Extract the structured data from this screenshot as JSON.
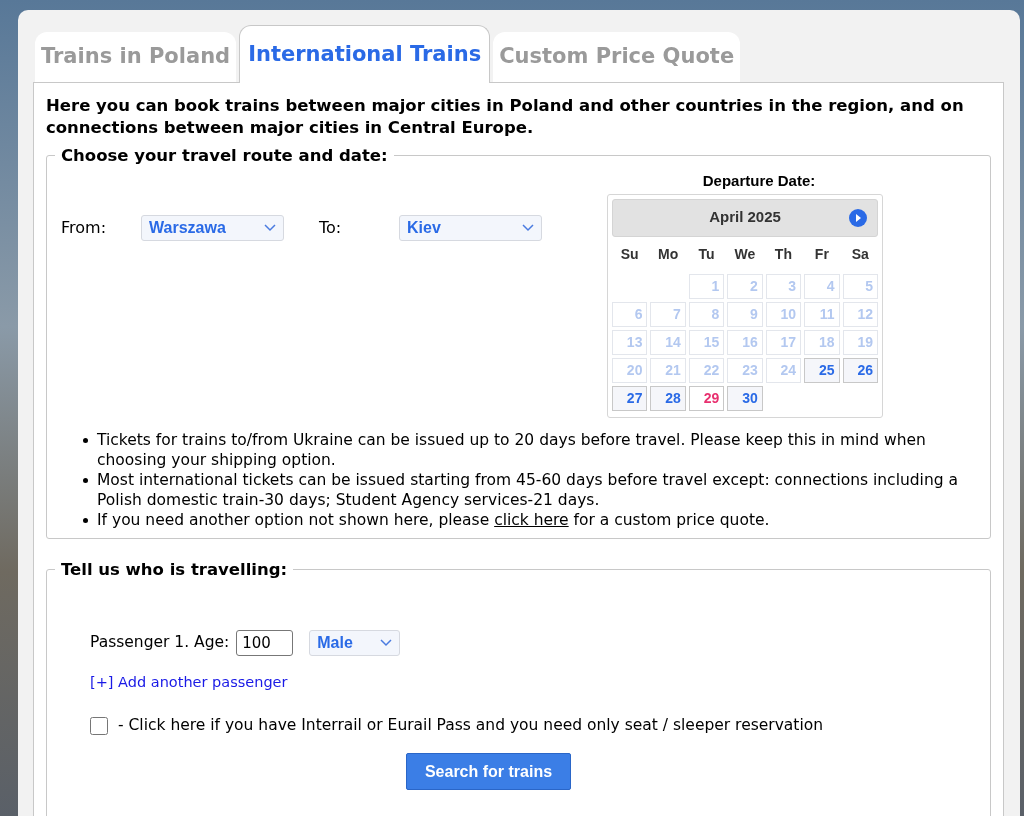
{
  "tabs": [
    {
      "label": "Trains in Poland",
      "selected": false
    },
    {
      "label": "International Trains",
      "selected": true
    },
    {
      "label": "Custom Price Quote",
      "selected": false
    }
  ],
  "intro": "Here you can book trains between major cities in Poland and other countries in the region, and on connections between major cities in Central Europe.",
  "route": {
    "legend": "Choose your travel route and date:",
    "from_label": "From:",
    "from_value": "Warszawa",
    "to_label": "To:",
    "to_value": "Kiev"
  },
  "calendar": {
    "heading": "Departure Date:",
    "month": "April 2025",
    "weekdays": [
      "Su",
      "Mo",
      "Tu",
      "We",
      "Th",
      "Fr",
      "Sa"
    ],
    "days": [
      {
        "label": "1",
        "kind": "disabled"
      },
      {
        "label": "2",
        "kind": "disabled"
      },
      {
        "label": "3",
        "kind": "disabled"
      },
      {
        "label": "4",
        "kind": "disabled"
      },
      {
        "label": "5",
        "kind": "disabled"
      },
      {
        "label": "6",
        "kind": "disabled"
      },
      {
        "label": "7",
        "kind": "disabled"
      },
      {
        "label": "8",
        "kind": "disabled"
      },
      {
        "label": "9",
        "kind": "disabled"
      },
      {
        "label": "10",
        "kind": "disabled"
      },
      {
        "label": "11",
        "kind": "disabled"
      },
      {
        "label": "12",
        "kind": "disabled"
      },
      {
        "label": "13",
        "kind": "disabled"
      },
      {
        "label": "14",
        "kind": "disabled"
      },
      {
        "label": "15",
        "kind": "disabled"
      },
      {
        "label": "16",
        "kind": "disabled"
      },
      {
        "label": "17",
        "kind": "disabled"
      },
      {
        "label": "18",
        "kind": "disabled"
      },
      {
        "label": "19",
        "kind": "disabled"
      },
      {
        "label": "20",
        "kind": "disabled"
      },
      {
        "label": "21",
        "kind": "disabled"
      },
      {
        "label": "22",
        "kind": "disabled"
      },
      {
        "label": "23",
        "kind": "disabled"
      },
      {
        "label": "24",
        "kind": "disabled"
      },
      {
        "label": "25",
        "kind": "available"
      },
      {
        "label": "26",
        "kind": "available"
      },
      {
        "label": "27",
        "kind": "available"
      },
      {
        "label": "28",
        "kind": "available"
      },
      {
        "label": "29",
        "kind": "highlighted"
      },
      {
        "label": "30",
        "kind": "available"
      }
    ]
  },
  "notes": [
    {
      "text": "Tickets for trains to/from Ukraine can be issued up to 20 days before travel. Please keep this in mind when choosing your shipping option."
    },
    {
      "text": "Most international tickets can be issued starting from 45-60 days before travel except: connections including a Polish domestic train-30 days; Student Agency services-21 days."
    },
    {
      "text_before": "If you need another option not shown here, please",
      "link": "click here",
      "text_after": "for a custom price quote."
    }
  ],
  "passengers": {
    "legend": "Tell us who is travelling:",
    "age_label": "Passenger 1. Age:",
    "age_value": "100",
    "gender": "Male",
    "add_link": "[+] Add another passenger",
    "pass_checked": false,
    "pass_label": "- Click here if you have Interrail or Eurail Pass and you need only seat / sleeper reservation",
    "search_button": "Search for trains"
  }
}
